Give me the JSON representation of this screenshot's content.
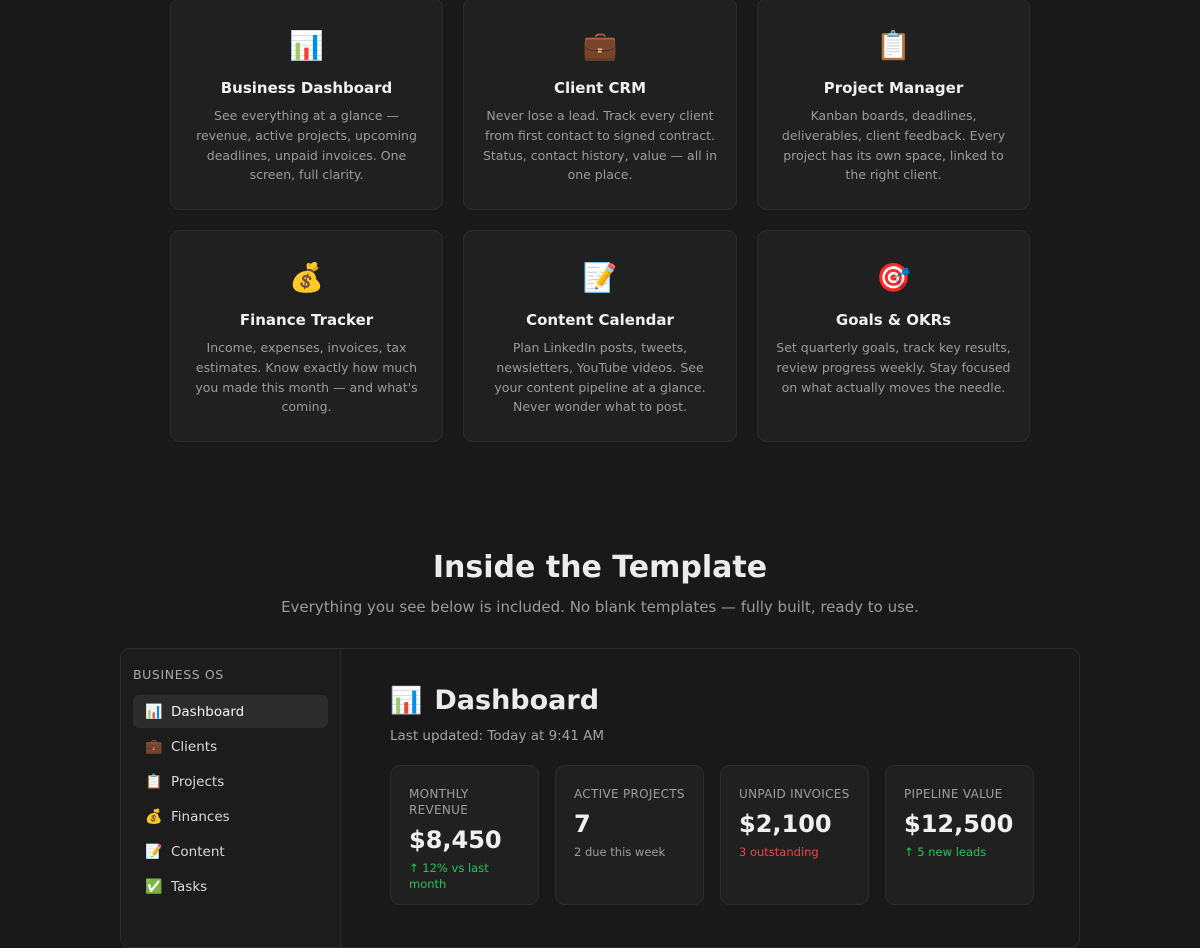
{
  "features": [
    {
      "icon": "📊",
      "icon_name": "bar-chart-icon",
      "title": "Business Dashboard",
      "desc": "See everything at a glance — revenue, active projects, upcoming deadlines, unpaid invoices. One screen, full clarity."
    },
    {
      "icon": "💼",
      "icon_name": "briefcase-icon",
      "title": "Client CRM",
      "desc": "Never lose a lead. Track every client from first contact to signed contract. Status, contact history, value — all in one place."
    },
    {
      "icon": "📋",
      "icon_name": "clipboard-icon",
      "title": "Project Manager",
      "desc": "Kanban boards, deadlines, deliverables, client feedback. Every project has its own space, linked to the right client."
    },
    {
      "icon": "💰",
      "icon_name": "money-bag-icon",
      "title": "Finance Tracker",
      "desc": "Income, expenses, invoices, tax estimates. Know exactly how much you made this month — and what's coming."
    },
    {
      "icon": "📝",
      "icon_name": "memo-icon",
      "title": "Content Calendar",
      "desc": "Plan LinkedIn posts, tweets, newsletters, YouTube videos. See your content pipeline at a glance. Never wonder what to post."
    },
    {
      "icon": "🎯",
      "icon_name": "target-icon",
      "title": "Goals & OKRs",
      "desc": "Set quarterly goals, track key results, review progress weekly. Stay focused on what actually moves the needle."
    }
  ],
  "section": {
    "title": "Inside the Template",
    "subtitle": "Everything you see below is included. No blank templates — fully built, ready to use."
  },
  "sidebar": {
    "heading": "BUSINESS OS",
    "items": [
      {
        "icon": "📊",
        "icon_name": "bar-chart-icon",
        "label": "Dashboard",
        "active": true
      },
      {
        "icon": "💼",
        "icon_name": "briefcase-icon",
        "label": "Clients"
      },
      {
        "icon": "📋",
        "icon_name": "clipboard-icon",
        "label": "Projects"
      },
      {
        "icon": "💰",
        "icon_name": "money-bag-icon",
        "label": "Finances"
      },
      {
        "icon": "📝",
        "icon_name": "memo-icon",
        "label": "Content"
      },
      {
        "icon": "✅",
        "icon_name": "check-box-icon",
        "label": "Tasks"
      }
    ]
  },
  "dashboard": {
    "icon": "📊",
    "title": "Dashboard",
    "updated": "Last updated: Today at 9:41 AM",
    "stats": [
      {
        "label": "MONTHLY REVENUE",
        "value": "$8,450",
        "note": "↑ 12% vs last month",
        "tone": "green"
      },
      {
        "label": "ACTIVE PROJECTS",
        "value": "7",
        "note": "2 due this week",
        "tone": "gray"
      },
      {
        "label": "UNPAID INVOICES",
        "value": "$2,100",
        "note": "3 outstanding",
        "tone": "red"
      },
      {
        "label": "PIPELINE VALUE",
        "value": "$12,500",
        "note": "↑ 5 new leads",
        "tone": "green"
      }
    ]
  },
  "colors": {
    "background": "#191919",
    "card": "#202020",
    "positive": "#22c55e",
    "negative": "#ef4444"
  }
}
